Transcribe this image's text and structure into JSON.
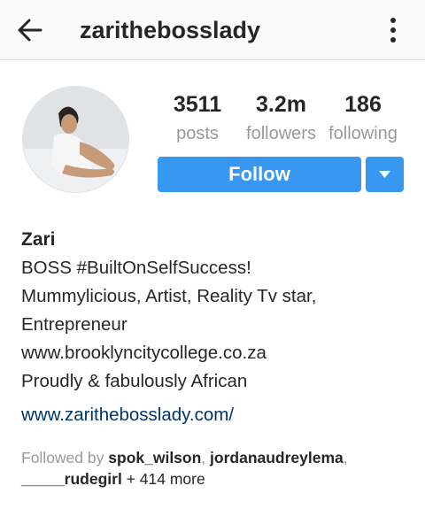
{
  "header": {
    "username": "zarithebosslady",
    "back_icon": "arrow-left-icon",
    "more_icon": "more-vertical-icon"
  },
  "stats": {
    "posts_value": "3511",
    "posts_label": "posts",
    "followers_value": "3.2m",
    "followers_label": "followers",
    "following_value": "186",
    "following_label": "following"
  },
  "actions": {
    "follow_label": "Follow",
    "dropdown_icon": "caret-down-icon",
    "accent_color": "#3897f0"
  },
  "bio": {
    "name": "Zari",
    "lines": [
      "BOSS #BuiltOnSelfSuccess!",
      "Mummylicious, Artist, Reality Tv star,",
      "Entrepreneur",
      "www.brooklyncitycollege.co.za",
      "Proudly & fabulously African"
    ],
    "website": "www.zarithebosslady.com/"
  },
  "followed_by": {
    "prefix": "Followed by",
    "users": [
      "spok_wilson",
      "jordanaudreylema",
      "_____rudegirl"
    ],
    "more": "+ 414 more"
  }
}
